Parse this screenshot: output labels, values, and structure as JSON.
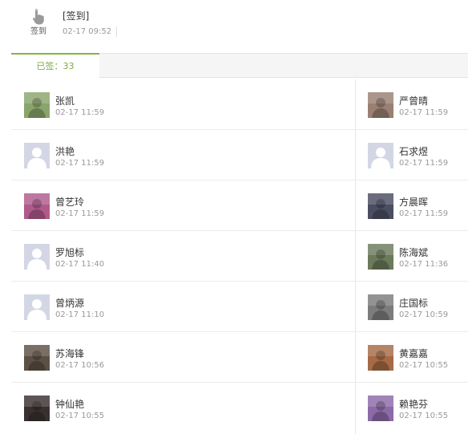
{
  "post": {
    "icon": "hand-pointer-icon",
    "icon_label": "签到",
    "title": "[签到]",
    "time": "02-17 09:52"
  },
  "tabs": [
    {
      "label": "已签：33",
      "active": true
    }
  ],
  "signins": [
    [
      {
        "name": "张凯",
        "time": "02-17 11:59",
        "avatar": "photo",
        "avatar_color": "#8aa56b"
      },
      {
        "name": "严曾晴",
        "time": "02-17 11:59",
        "avatar": "photo",
        "avatar_color": "#9a7f72"
      }
    ],
    [
      {
        "name": "洪艳",
        "time": "02-17 11:59",
        "avatar": "default",
        "avatar_color": "#d3d7e5"
      },
      {
        "name": "石求煜",
        "time": "02-17 11:59",
        "avatar": "default",
        "avatar_color": "#d3d7e5"
      }
    ],
    [
      {
        "name": "曾艺玲",
        "time": "02-17 11:59",
        "avatar": "photo",
        "avatar_color": "#b05a8c"
      },
      {
        "name": "方晨晖",
        "time": "02-17 11:59",
        "avatar": "photo",
        "avatar_color": "#4b4e63"
      }
    ],
    [
      {
        "name": "罗旭标",
        "time": "02-17 11:40",
        "avatar": "default",
        "avatar_color": "#d3d7e5"
      },
      {
        "name": "陈海斌",
        "time": "02-17 11:36",
        "avatar": "photo",
        "avatar_color": "#6b7a5a"
      }
    ],
    [
      {
        "name": "曾炳源",
        "time": "02-17 11:10",
        "avatar": "default",
        "avatar_color": "#d3d7e5"
      },
      {
        "name": "庄国标",
        "time": "02-17 10:59",
        "avatar": "photo",
        "avatar_color": "#7c7c7c"
      }
    ],
    [
      {
        "name": "苏海锋",
        "time": "02-17 10:56",
        "avatar": "photo",
        "avatar_color": "#5d5044"
      },
      {
        "name": "黄嘉嘉",
        "time": "02-17 10:55",
        "avatar": "photo",
        "avatar_color": "#a66a45"
      }
    ],
    [
      {
        "name": "钟仙艳",
        "time": "02-17 10:55",
        "avatar": "photo",
        "avatar_color": "#3a3030"
      },
      {
        "name": "赖艳芬",
        "time": "02-17 10:55",
        "avatar": "photo",
        "avatar_color": "#8c6aa8"
      }
    ]
  ]
}
